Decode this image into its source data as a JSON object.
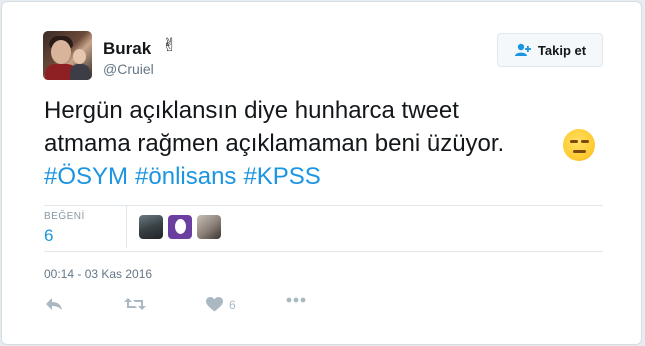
{
  "tweet": {
    "author": {
      "name": "Burak",
      "name_emoji": "✌",
      "handle": "@Cruiel"
    },
    "follow_button": {
      "label": "Takip et",
      "icon": "add-user-icon"
    },
    "text": "Hergün açıklansın diye hunharca tweet\natmama rağmen açıklamaman beni üzüyor.",
    "text_emoji": "unamused-face-emoji",
    "hashtags": [
      "#ÖSYM",
      "#önlisans",
      "#KPSS"
    ],
    "stats": {
      "likes_label": "BEĞENİ",
      "likes_count": "6",
      "likers": [
        "avatar-1",
        "avatar-egg",
        "avatar-3"
      ]
    },
    "timestamp": "00:14 - 03 Kas 2016",
    "actions": {
      "reply_icon": "reply-icon",
      "retweet_icon": "retweet-icon",
      "like_icon": "heart-icon",
      "like_count": "6",
      "more_icon": "more-icon"
    }
  },
  "colors": {
    "link": "#1b95e0",
    "muted": "#657786",
    "icon": "#aab8c2",
    "background": "#e6ecf0"
  }
}
